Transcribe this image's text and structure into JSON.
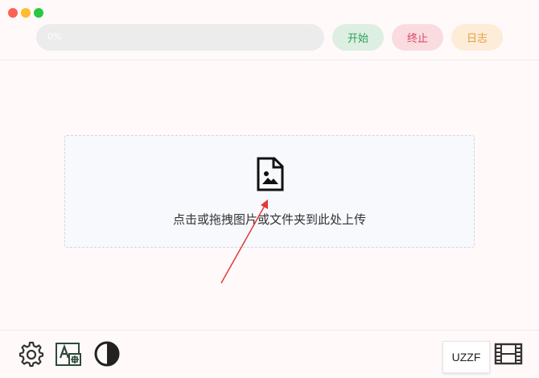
{
  "window": {
    "controls": [
      "close",
      "minimize",
      "maximize"
    ]
  },
  "toolbar": {
    "progress": {
      "label": "0%",
      "value": 0
    },
    "start_label": "开始",
    "stop_label": "终止",
    "log_label": "日志"
  },
  "dropzone": {
    "icon": "image-file-icon",
    "text": "点击或拖拽图片或文件夹到此处上传"
  },
  "footer": {
    "tools": [
      "gear-icon",
      "font-add-icon",
      "contrast-icon",
      "film-icon"
    ],
    "badge_label": "UZZF"
  },
  "colors": {
    "background": "#fffaf9",
    "start": "#2f9e58",
    "stop": "#d94561",
    "log": "#e0a040",
    "annotation": "#e03a3a"
  }
}
